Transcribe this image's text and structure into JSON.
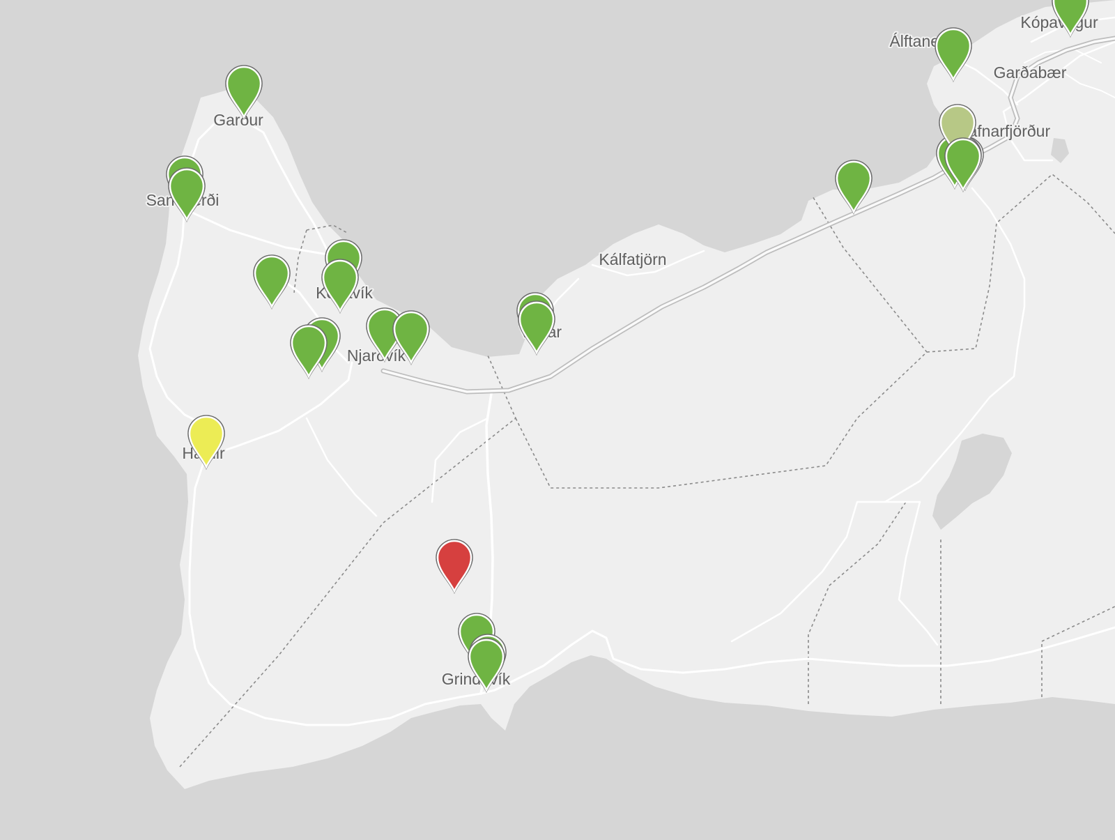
{
  "colors": {
    "sea": "#d6d6d6",
    "land": "#efefef",
    "road": "#ffffff",
    "highway_casing": "#bdbdbd",
    "boundary": "#8a8a8a",
    "label_text": "#5f5f5f",
    "marker_good": "#6fb443",
    "marker_fair": "#b7c886",
    "marker_moderate": "#ecec55",
    "marker_poor": "#d6403f"
  },
  "icons": {
    "marker": "map-pin-icon"
  },
  "places": [
    {
      "id": "gardur",
      "name": "Garður"
    },
    {
      "id": "sandgerdi",
      "name": "Sandgerði"
    },
    {
      "id": "keflavik",
      "name": "Keflavík"
    },
    {
      "id": "njardvik",
      "name": "Njarðvík"
    },
    {
      "id": "vogar",
      "name": "Vogar"
    },
    {
      "id": "kalfatjorn",
      "name": "Kálfatjörn"
    },
    {
      "id": "hafnir",
      "name": "Hafnir"
    },
    {
      "id": "grindavik",
      "name": "Grindavík"
    },
    {
      "id": "alftanes",
      "name": "Álftanes"
    },
    {
      "id": "kopavogur",
      "name": "Kópavogur"
    },
    {
      "id": "gardabaer",
      "name": "Garðabær"
    },
    {
      "id": "hafnarfjordur",
      "name": "Hafnarfjörður"
    }
  ],
  "markers": [
    {
      "status": "good"
    },
    {
      "status": "good"
    },
    {
      "status": "good"
    },
    {
      "status": "good"
    },
    {
      "status": "good"
    },
    {
      "status": "good"
    },
    {
      "status": "good"
    },
    {
      "status": "good"
    },
    {
      "status": "good"
    },
    {
      "status": "good"
    },
    {
      "status": "good"
    },
    {
      "status": "good"
    },
    {
      "status": "good"
    },
    {
      "status": "good"
    },
    {
      "status": "good"
    },
    {
      "status": "good"
    },
    {
      "status": "good"
    },
    {
      "status": "good"
    },
    {
      "status": "fair"
    },
    {
      "status": "good"
    },
    {
      "status": "moderate"
    },
    {
      "status": "poor"
    },
    {
      "status": "good"
    },
    {
      "status": "good"
    },
    {
      "status": "good"
    }
  ]
}
